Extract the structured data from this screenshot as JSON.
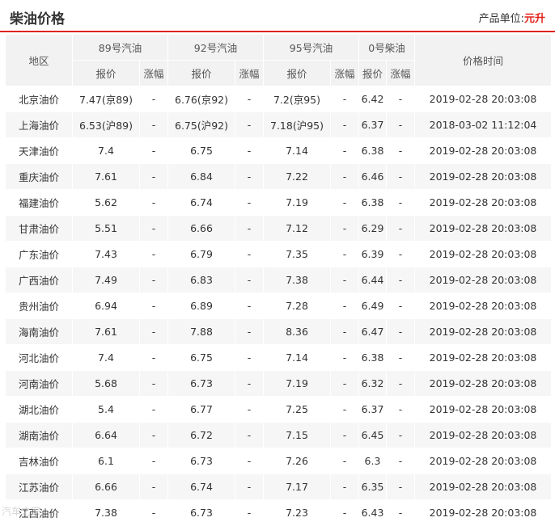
{
  "header": {
    "title": "柴油价格",
    "unit_label": "产品单位:",
    "unit_value": "元升"
  },
  "table": {
    "headers": {
      "region": "地区",
      "fuel89": "89号汽油",
      "fuel92": "92号汽油",
      "fuel95": "95号汽油",
      "fuel0": "0号柴油",
      "price": "报价",
      "change": "涨幅",
      "time": "价格时间"
    },
    "rows": [
      {
        "region": "北京油价",
        "p89": "7.47(京89)",
        "c89": "-",
        "p92": "6.76(京92)",
        "c92": "-",
        "p95": "7.2(京95)",
        "c95": "-",
        "p0": "6.42",
        "c0": "-",
        "time": "2019-02-28 20:03:08"
      },
      {
        "region": "上海油价",
        "p89": "6.53(沪89)",
        "c89": "-",
        "p92": "6.75(沪92)",
        "c92": "-",
        "p95": "7.18(沪95)",
        "c95": "-",
        "p0": "6.37",
        "c0": "-",
        "time": "2018-03-02 11:12:04"
      },
      {
        "region": "天津油价",
        "p89": "7.4",
        "c89": "-",
        "p92": "6.75",
        "c92": "-",
        "p95": "7.14",
        "c95": "-",
        "p0": "6.38",
        "c0": "-",
        "time": "2019-02-28 20:03:08"
      },
      {
        "region": "重庆油价",
        "p89": "7.61",
        "c89": "-",
        "p92": "6.84",
        "c92": "-",
        "p95": "7.22",
        "c95": "-",
        "p0": "6.46",
        "c0": "-",
        "time": "2019-02-28 20:03:08"
      },
      {
        "region": "福建油价",
        "p89": "5.62",
        "c89": "-",
        "p92": "6.74",
        "c92": "-",
        "p95": "7.19",
        "c95": "-",
        "p0": "6.38",
        "c0": "-",
        "time": "2019-02-28 20:03:08"
      },
      {
        "region": "甘肃油价",
        "p89": "5.51",
        "c89": "-",
        "p92": "6.66",
        "c92": "-",
        "p95": "7.12",
        "c95": "-",
        "p0": "6.29",
        "c0": "-",
        "time": "2019-02-28 20:03:08"
      },
      {
        "region": "广东油价",
        "p89": "7.43",
        "c89": "-",
        "p92": "6.79",
        "c92": "-",
        "p95": "7.35",
        "c95": "-",
        "p0": "6.39",
        "c0": "-",
        "time": "2019-02-28 20:03:08"
      },
      {
        "region": "广西油价",
        "p89": "7.49",
        "c89": "-",
        "p92": "6.83",
        "c92": "-",
        "p95": "7.38",
        "c95": "-",
        "p0": "6.44",
        "c0": "-",
        "time": "2019-02-28 20:03:08"
      },
      {
        "region": "贵州油价",
        "p89": "6.94",
        "c89": "-",
        "p92": "6.89",
        "c92": "-",
        "p95": "7.28",
        "c95": "-",
        "p0": "6.49",
        "c0": "-",
        "time": "2019-02-28 20:03:08"
      },
      {
        "region": "海南油价",
        "p89": "7.61",
        "c89": "-",
        "p92": "7.88",
        "c92": "-",
        "p95": "8.36",
        "c95": "-",
        "p0": "6.47",
        "c0": "-",
        "time": "2019-02-28 20:03:08"
      },
      {
        "region": "河北油价",
        "p89": "7.4",
        "c89": "-",
        "p92": "6.75",
        "c92": "-",
        "p95": "7.14",
        "c95": "-",
        "p0": "6.38",
        "c0": "-",
        "time": "2019-02-28 20:03:08"
      },
      {
        "region": "河南油价",
        "p89": "5.68",
        "c89": "-",
        "p92": "6.73",
        "c92": "-",
        "p95": "7.19",
        "c95": "-",
        "p0": "6.32",
        "c0": "-",
        "time": "2019-02-28 20:03:08"
      },
      {
        "region": "湖北油价",
        "p89": "5.4",
        "c89": "-",
        "p92": "6.77",
        "c92": "-",
        "p95": "7.25",
        "c95": "-",
        "p0": "6.37",
        "c0": "-",
        "time": "2019-02-28 20:03:08"
      },
      {
        "region": "湖南油价",
        "p89": "6.64",
        "c89": "-",
        "p92": "6.72",
        "c92": "-",
        "p95": "7.15",
        "c95": "-",
        "p0": "6.45",
        "c0": "-",
        "time": "2019-02-28 20:03:08"
      },
      {
        "region": "吉林油价",
        "p89": "6.1",
        "c89": "-",
        "p92": "6.73",
        "c92": "-",
        "p95": "7.26",
        "c95": "-",
        "p0": "6.3",
        "c0": "-",
        "time": "2019-02-28 20:03:08"
      },
      {
        "region": "江苏油价",
        "p89": "6.66",
        "c89": "-",
        "p92": "6.74",
        "c92": "-",
        "p95": "7.17",
        "c95": "-",
        "p0": "6.35",
        "c0": "-",
        "time": "2019-02-28 20:03:08"
      },
      {
        "region": "江西油价",
        "p89": "7.38",
        "c89": "-",
        "p92": "6.73",
        "c92": "-",
        "p95": "7.23",
        "c95": "-",
        "p0": "6.43",
        "c0": "-",
        "time": "2019-02-28 20:03:08"
      }
    ]
  },
  "watermark": "汽车之家"
}
